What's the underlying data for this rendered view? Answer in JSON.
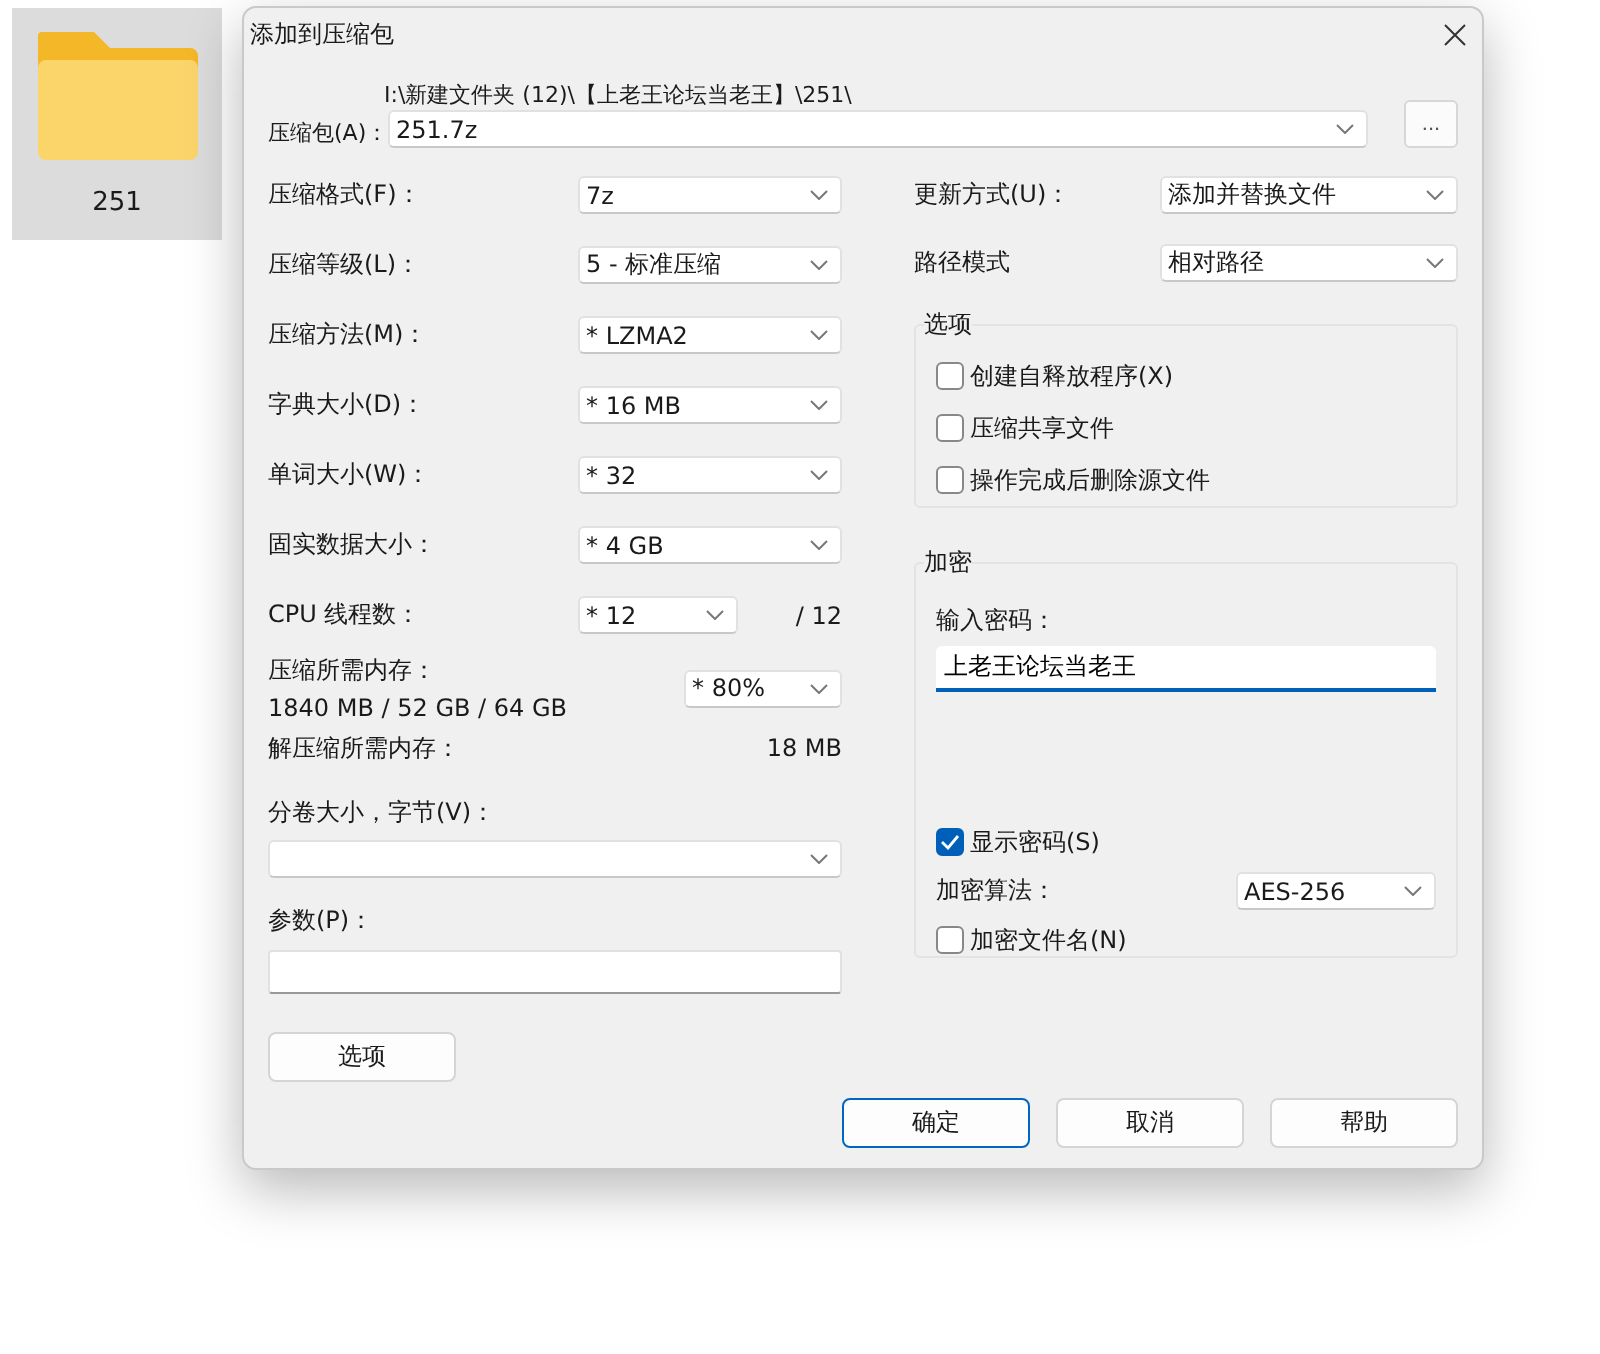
{
  "folder": {
    "name": "251"
  },
  "dialog": {
    "title": "添加到压缩包",
    "archive": {
      "label": "压缩包(A)：",
      "path": "I:\\新建文件夹 (12)\\【上老王论坛当老王】\\251\\",
      "value": "251.7z",
      "browse": "..."
    },
    "left_fields": [
      {
        "label": "压缩格式(F)：",
        "value": "7z"
      },
      {
        "label": "压缩等级(L)：",
        "value": "5 - 标准压缩"
      },
      {
        "label": "压缩方法(M)：",
        "value": "* LZMA2"
      },
      {
        "label": "字典大小(D)：",
        "value": "* 16 MB"
      },
      {
        "label": "单词大小(W)：",
        "value": "* 32"
      },
      {
        "label": "固实数据大小：",
        "value": "* 4 GB"
      }
    ],
    "threads": {
      "label": "CPU 线程数：",
      "value": "* 12",
      "max": "/ 12"
    },
    "memory": {
      "label": "压缩所需内存：",
      "usage": "1840 MB / 52 GB / 64 GB",
      "value": "* 80%"
    },
    "decompress_memory": {
      "label": "解压缩所需内存：",
      "value": "18 MB"
    },
    "volume": {
      "label": "分卷大小，字节(V)："
    },
    "parameters": {
      "label": "参数(P)："
    },
    "options_button": "选项",
    "right_fields": [
      {
        "label": "更新方式(U)：",
        "value": "添加并替换文件"
      },
      {
        "label": "路径模式",
        "value": "相对路径"
      }
    ],
    "options": {
      "legend": "选项",
      "checkboxes": [
        {
          "label": "创建自释放程序(X)",
          "checked": false
        },
        {
          "label": "压缩共享文件",
          "checked": false
        },
        {
          "label": "操作完成后删除源文件",
          "checked": false
        }
      ]
    },
    "encryption": {
      "legend": "加密",
      "password_label": "输入密码：",
      "password": "上老王论坛当老王",
      "show_password": {
        "label": "显示密码(S)",
        "checked": true
      },
      "method": {
        "label": "加密算法：",
        "value": "AES-256"
      },
      "encrypt_names": {
        "label": "加密文件名(N)",
        "checked": false
      }
    },
    "buttons": [
      {
        "label": "确定",
        "default": true
      },
      {
        "label": "取消",
        "default": false
      },
      {
        "label": "帮助",
        "default": false
      }
    ]
  }
}
